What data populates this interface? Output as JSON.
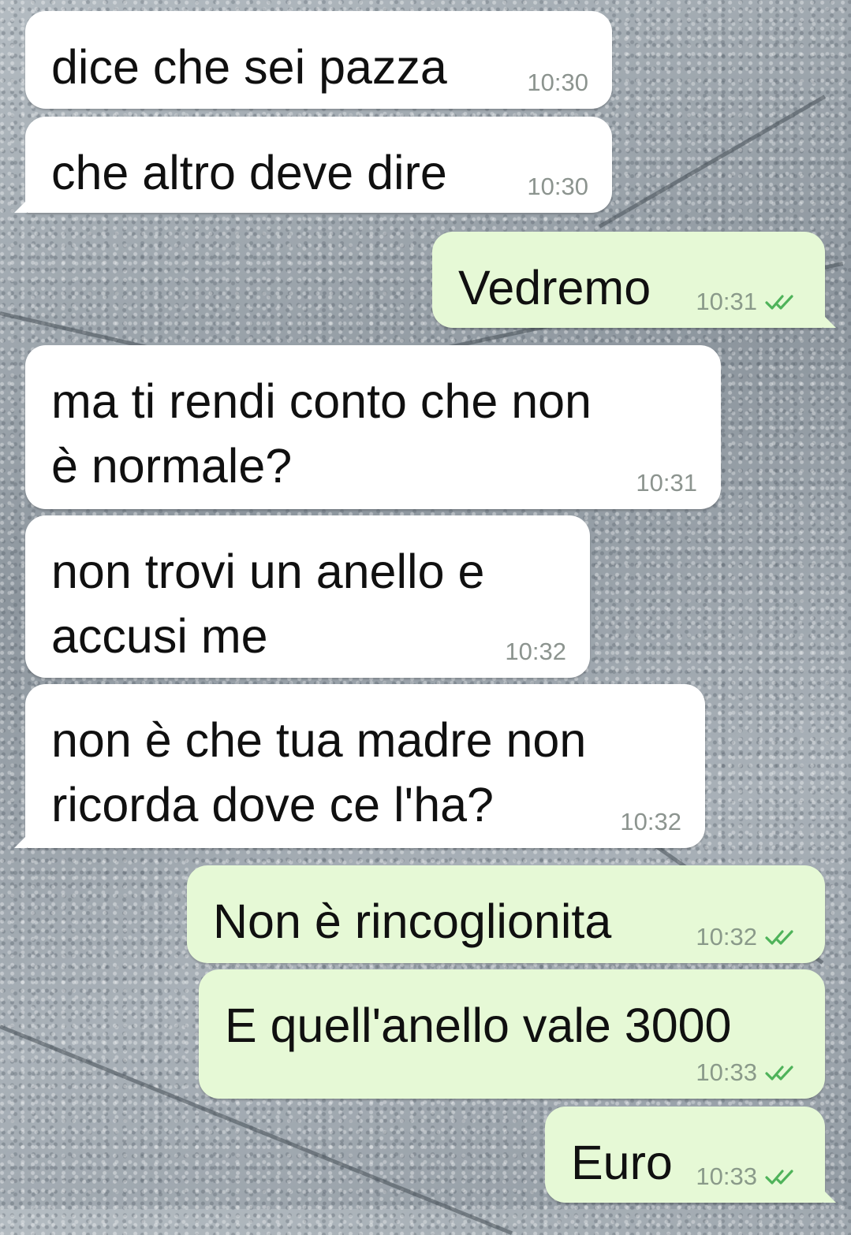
{
  "theme": {
    "incoming_bubble_color": "#ffffff",
    "outgoing_bubble_color": "#e6f9d6",
    "read_check_color": "#4fb35a",
    "time_color": "#8c948f"
  },
  "messages": [
    {
      "direction": "incoming",
      "text": "dice che sei pazza",
      "time": "10:30"
    },
    {
      "direction": "incoming",
      "text": "che altro deve dire",
      "time": "10:30"
    },
    {
      "direction": "outgoing",
      "text": "Vedremo",
      "time": "10:31",
      "status_icon": "double-check-icon"
    },
    {
      "direction": "incoming",
      "text": "ma ti rendi conto che non\nè normale?",
      "time": "10:31"
    },
    {
      "direction": "incoming",
      "text": "non trovi un anello e\naccusi me",
      "time": "10:32"
    },
    {
      "direction": "incoming",
      "text": "non è che tua madre non\nricorda dove ce l'ha?",
      "time": "10:32"
    },
    {
      "direction": "outgoing",
      "text": "Non è rincoglionita",
      "time": "10:32",
      "status_icon": "double-check-icon"
    },
    {
      "direction": "outgoing",
      "text": "E quell'anello vale 3000",
      "time": "10:33",
      "status_icon": "double-check-icon"
    },
    {
      "direction": "outgoing",
      "text": "Euro",
      "time": "10:33",
      "status_icon": "double-check-icon"
    }
  ]
}
